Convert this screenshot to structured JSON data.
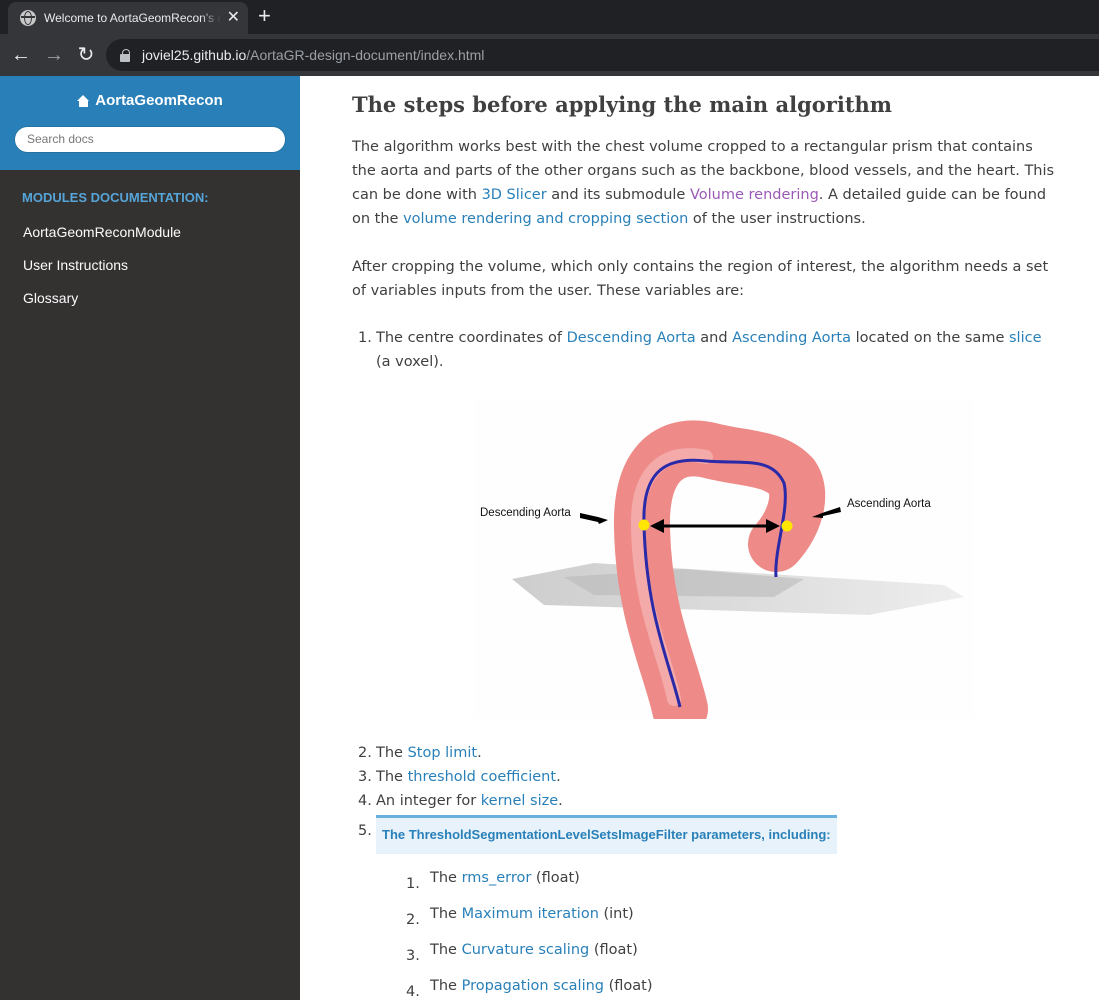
{
  "browser": {
    "tab_title": "Welcome to AortaGeomRecon's documentation",
    "tab_close": "✕",
    "new_tab": "+",
    "url_host": "joviel25.github.io",
    "url_path": "/AortaGR-design-document/index.html"
  },
  "sidebar": {
    "brand": "AortaGeomRecon",
    "search_placeholder": "Search docs",
    "caption": "Modules documentation:",
    "items": [
      {
        "label": "AortaGeomReconModule"
      },
      {
        "label": "User Instructions"
      },
      {
        "label": "Glossary"
      }
    ]
  },
  "content": {
    "heading": "The steps before applying the main algorithm",
    "p1": {
      "a": "The algorithm works best with the chest volume cropped to a rectangular prism that contains the aorta and parts of the other organs such as the backbone, blood vessels, and the heart. This can be done with ",
      "link1": "3D Slicer",
      "b": " and its submodule ",
      "link2": "Volume rendering",
      "c": ". A detailed guide can be found on the ",
      "link3": "volume rendering and cropping section",
      "d": " of the user instructions."
    },
    "p2": "After cropping the volume, which only contains the region of interest, the algorithm needs a set of variables inputs from the user. These variables are:",
    "list": {
      "item1": {
        "num": "1.",
        "a": "The centre coordinates of ",
        "link1": "Descending Aorta",
        "b": " and ",
        "link2": "Ascending Aorta",
        "c": " located on the same ",
        "link3": "slice",
        "d": " (a voxel)."
      },
      "figure": {
        "label_left": "Descending Aorta",
        "label_right": "Ascending Aorta"
      },
      "item2": {
        "num": "2.",
        "a": "The ",
        "link": "Stop limit",
        "b": "."
      },
      "item3": {
        "num": "3.",
        "a": "The ",
        "link": "threshold coefficient",
        "b": "."
      },
      "item4": {
        "num": "4.",
        "a": "An integer for ",
        "link": "kernel size",
        "b": "."
      },
      "item5": {
        "num": "5.",
        "rubric": "The ThresholdSegmentationLevelSetsImageFilter parameters, including:"
      },
      "sub": [
        {
          "num": "1.",
          "a": "The ",
          "link": "rms_error",
          "b": " (float)"
        },
        {
          "num": "2.",
          "a": "The ",
          "link": "Maximum iteration",
          "b": " (int)"
        },
        {
          "num": "3.",
          "a": "The ",
          "link": "Curvature scaling",
          "b": " (float)"
        },
        {
          "num": "4.",
          "a": "The ",
          "link": "Propagation scaling",
          "b": " (float)"
        }
      ]
    }
  }
}
